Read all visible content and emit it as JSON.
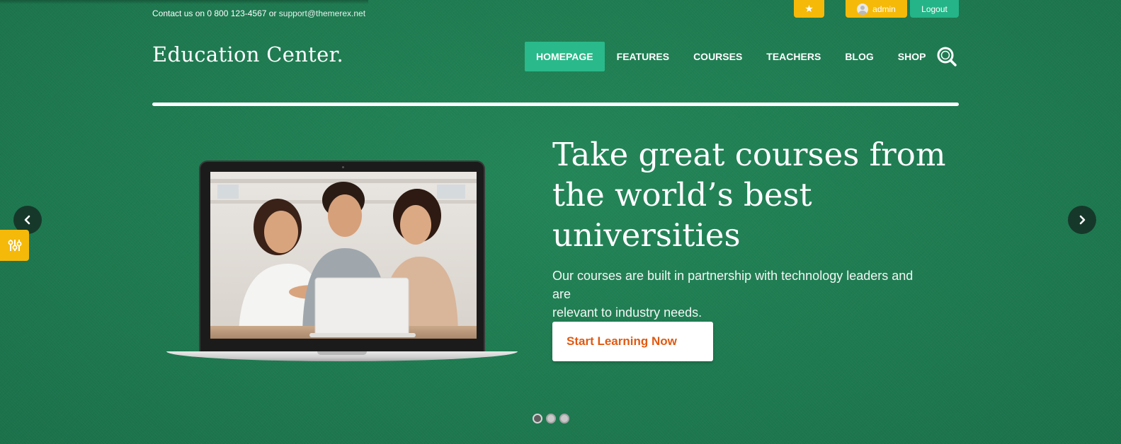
{
  "topbar": {
    "contact_prefix": "Contact us on 0 800 123-4567 or ",
    "contact_email": "support@themerex.net",
    "user_name": "admin",
    "logout_label": "Logout"
  },
  "header": {
    "logo_text": "Education Center.",
    "nav": [
      {
        "label": "HOMEPAGE",
        "active": true
      },
      {
        "label": "FEATURES"
      },
      {
        "label": "COURSES"
      },
      {
        "label": "TEACHERS"
      },
      {
        "label": "BLOG"
      },
      {
        "label": "SHOP"
      }
    ]
  },
  "hero": {
    "title_lines": [
      "Take great courses from",
      "the world’s best",
      "universities"
    ],
    "subtitle_lines": [
      "Our courses are built in partnership with technology leaders and are",
      "relevant to industry needs."
    ],
    "cta_label": "Start Learning Now"
  },
  "slider": {
    "slide_count": 3,
    "active_index": 0
  },
  "colors": {
    "background": "#1f7a52",
    "accent_green": "#2ab98a",
    "accent_yellow": "#f5b90a",
    "cta_text": "#e05a12"
  },
  "icons": [
    "star-icon",
    "user-avatar-icon",
    "search-icon",
    "chevron-left-icon",
    "chevron-right-icon",
    "sliders-icon"
  ]
}
